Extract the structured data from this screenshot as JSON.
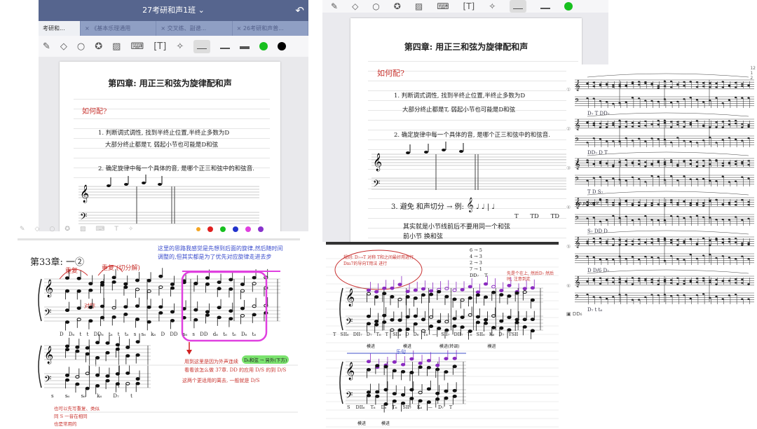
{
  "notebook": {
    "title": "27考研和声1班",
    "tabs": [
      "考研和...",
      "《基本乐理通用",
      "交叉练、副谱...",
      "26考研和声普..."
    ],
    "toolbar_icons": [
      "pen-icon",
      "shapes-icon",
      "lasso-icon",
      "sticker-icon",
      "image-icon",
      "keyboard-icon",
      "text-box-icon",
      "laser-pointer-icon"
    ],
    "colors": {
      "header": "#56658e",
      "green": "#17c01f",
      "black": "#000000"
    }
  },
  "note_page": {
    "title": "第四章: 用正三和弦为旋律配和声",
    "question": "如何配?",
    "step1_line1": "1. 判断调式调性, 找到半终止位置,半终止多数为D",
    "step1_line2": "大部分终止都是T, 弱起小节也可能是D和弦",
    "step2": "2. 确定旋律中每一个具体的音, 是哪个正三和弦中的和弦音.",
    "step3": "3. 避免 和声切分 → 例:",
    "step3_labels": [
      "T",
      "TD",
      "TD"
    ],
    "step3_note": "其实就是小节线前后不要用同一个和弦",
    "step3_note2": "前小节 换和弦"
  },
  "exercise_33": {
    "title": "第33章: 一②",
    "red_note1": "重复",
    "red_note2": "重复 (切分解)",
    "red_note3": "对称",
    "blue_note": "这里的思路我感觉是先想到后面的旋律,然后随时间调整的,但其实都是为了优先对应旋律走进去步",
    "chords_row1": [
      "D",
      "D₆",
      "t",
      "t",
      "DD₆",
      "t₆",
      "t",
      "t₆",
      "s",
      "s₆",
      "k₆",
      "D",
      "DD",
      "s₆",
      "s",
      "DD",
      "d₆",
      "t₆",
      "t₆",
      "D₆",
      "t₆"
    ],
    "chords_row2": [
      "s",
      "s₆",
      "s₆",
      "k₆",
      "D₇",
      "t"
    ],
    "red_explain1": "用到这里是因为外声连续",
    "green_tag": "D₆和弦 → 另外(下方)",
    "red_explain2": "看看该怎么做 37章. DD 的应用 D/S 的到 D/S",
    "red_explain3": "这两个更适用的离去, 一般就是 D/S",
    "footer_note1": "也可以先写重复、类似",
    "footer_note2": "同 S 一音在相同",
    "footer_note3": "也是常用的"
  },
  "exercise_right": {
    "circle_note": "规则: D₇→T 对称 T和之间最好用进行 Dm7的导向T用法 进行",
    "resolution": [
      "6 → 5",
      "4 → 3",
      "2 → 3",
      "7 → 1"
    ],
    "resolution_labels": [
      "DD₇",
      "T"
    ],
    "red_note": "先是个在上, 然后D₇ 然后时, 注意到走",
    "chords_row1": [
      "T",
      "SII₆",
      "DII₇",
      "D₇",
      "T₆",
      "T",
      "SII₆",
      "D",
      "D₆",
      "T₆",
      "—",
      "SII₇",
      "DII₇",
      "T₆",
      "SII₆",
      "K₆",
      "D₇",
      "TSII"
    ],
    "chords_row2": [
      "S",
      "DII₆",
      "T₆",
      "D₆",
      "T₆",
      "SII₇",
      "K₆",
      "—",
      "D₇",
      "T"
    ],
    "marks": [
      "模进",
      "模进",
      "模进(转调)",
      "模进"
    ],
    "phrase_label": "乐句",
    "marks2": [
      "模进",
      "模进"
    ]
  },
  "printed_score": {
    "page_numbers": [
      "12",
      "1",
      "2"
    ],
    "systems": [
      "①",
      "②",
      "③",
      "④",
      "⑤",
      "⑥"
    ],
    "dynamics": [
      "f",
      "pp poco rit.",
      "f"
    ],
    "annotations": [
      "D₇",
      "T",
      "DD₇",
      "D",
      "T",
      "D",
      "S₇",
      "DD",
      "D",
      "D/6",
      "D₇",
      "t",
      "t₆"
    ],
    "footer": [
      "DD₆",
      "6",
      "4",
      "2",
      "7",
      "DD₆"
    ]
  }
}
